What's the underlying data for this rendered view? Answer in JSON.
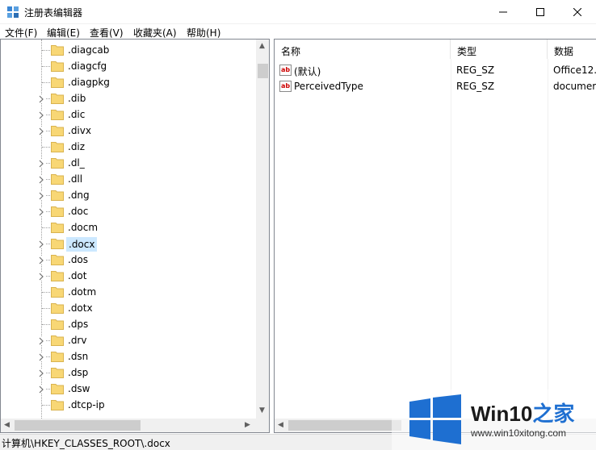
{
  "window": {
    "title": "注册表编辑器"
  },
  "menu": [
    {
      "label": "文件(F)"
    },
    {
      "label": "编辑(E)"
    },
    {
      "label": "查看(V)"
    },
    {
      "label": "收藏夹(A)"
    },
    {
      "label": "帮助(H)"
    }
  ],
  "tree": {
    "items": [
      {
        "label": ".diagcab",
        "expandable": false
      },
      {
        "label": ".diagcfg",
        "expandable": false
      },
      {
        "label": ".diagpkg",
        "expandable": false
      },
      {
        "label": ".dib",
        "expandable": true
      },
      {
        "label": ".dic",
        "expandable": true
      },
      {
        "label": ".divx",
        "expandable": true
      },
      {
        "label": ".diz",
        "expandable": false
      },
      {
        "label": ".dl_",
        "expandable": true
      },
      {
        "label": ".dll",
        "expandable": true
      },
      {
        "label": ".dng",
        "expandable": true
      },
      {
        "label": ".doc",
        "expandable": true
      },
      {
        "label": ".docm",
        "expandable": false
      },
      {
        "label": ".docx",
        "expandable": true,
        "selected": true
      },
      {
        "label": ".dos",
        "expandable": true
      },
      {
        "label": ".dot",
        "expandable": true
      },
      {
        "label": ".dotm",
        "expandable": false
      },
      {
        "label": ".dotx",
        "expandable": false
      },
      {
        "label": ".dps",
        "expandable": false
      },
      {
        "label": ".drv",
        "expandable": true
      },
      {
        "label": ".dsn",
        "expandable": true
      },
      {
        "label": ".dsp",
        "expandable": true
      },
      {
        "label": ".dsw",
        "expandable": true
      },
      {
        "label": ".dtcp-ip",
        "expandable": false
      }
    ]
  },
  "list": {
    "headers": {
      "name": "名称",
      "type": "类型",
      "data": "数据"
    },
    "rows": [
      {
        "name": "(默认)",
        "type": "REG_SZ",
        "data": "Office12."
      },
      {
        "name": "PerceivedType",
        "type": "REG_SZ",
        "data": "documer"
      }
    ]
  },
  "status": {
    "path": "计算机\\HKEY_CLASSES_ROOT\\.docx"
  },
  "watermark": {
    "title_a": "Win10",
    "title_b": "之家",
    "url": "www.win10xitong.com"
  },
  "colors": {
    "selection": "#cce8ff",
    "folder": "#f8d775",
    "accent": "#1e6fd1"
  }
}
